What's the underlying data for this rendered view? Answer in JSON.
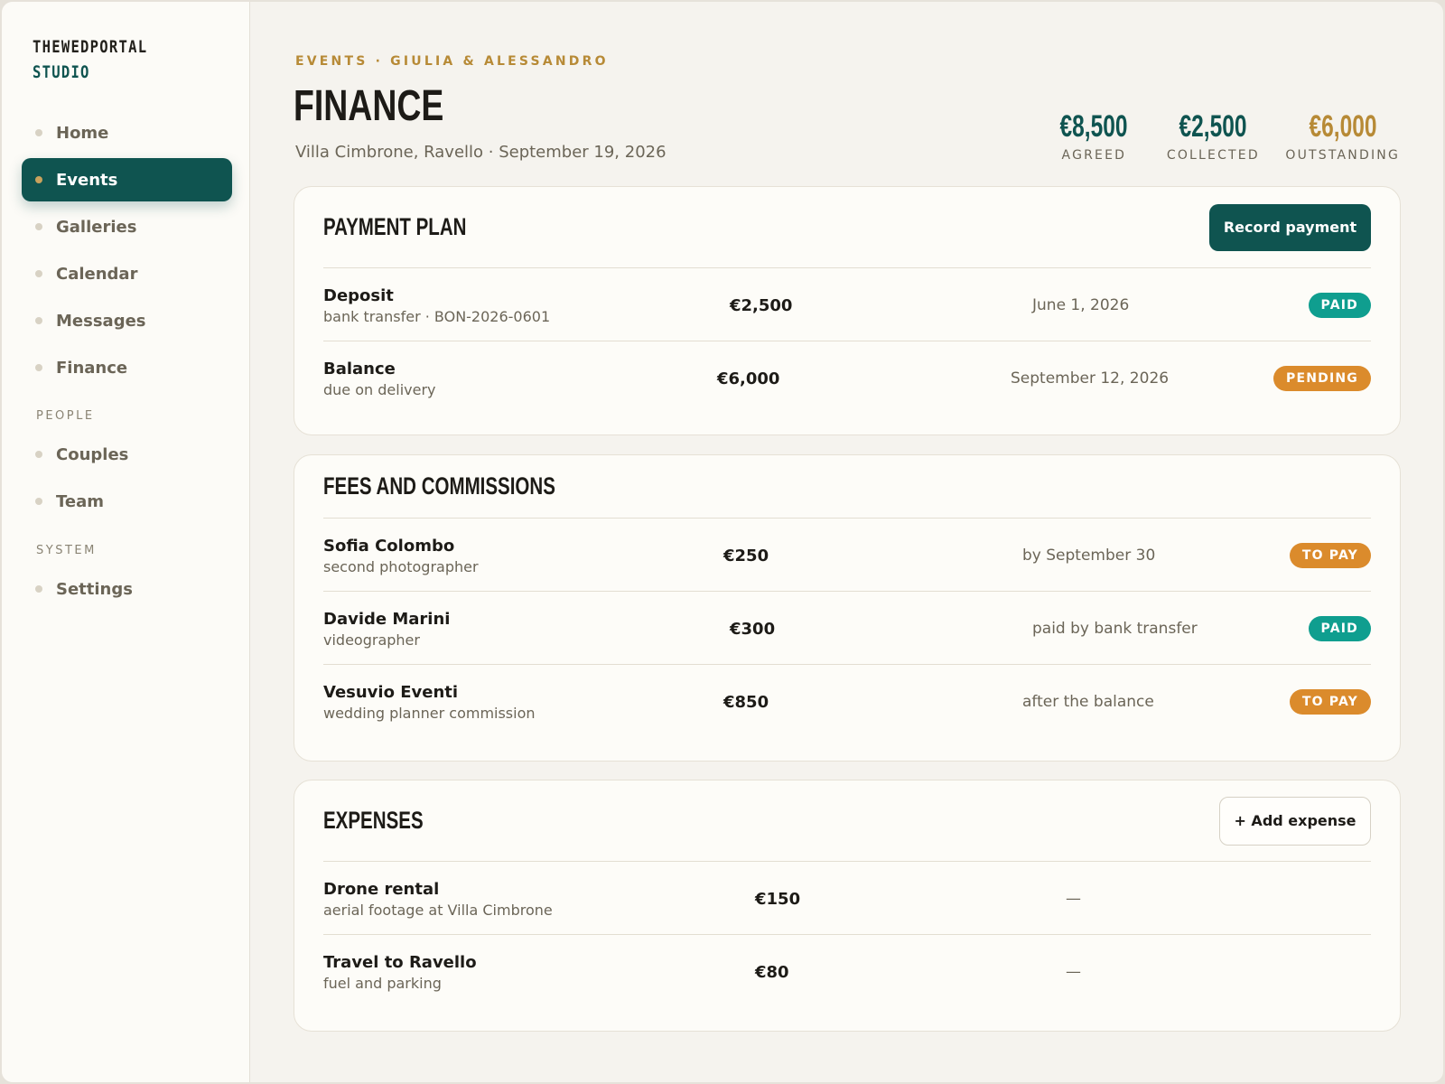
{
  "brand": {
    "line1": "THEWEDPORTAL",
    "line2": "STUDIO"
  },
  "sidebar": {
    "items": [
      {
        "label": "Home"
      },
      {
        "label": "Events"
      },
      {
        "label": "Galleries"
      },
      {
        "label": "Calendar"
      },
      {
        "label": "Messages"
      },
      {
        "label": "Finance"
      }
    ],
    "people_label": "PEOPLE",
    "people_items": [
      {
        "label": "Couples"
      },
      {
        "label": "Team"
      }
    ],
    "system_label": "SYSTEM",
    "system_items": [
      {
        "label": "Settings"
      }
    ]
  },
  "header": {
    "breadcrumb": "EVENTS · GIULIA & ALESSANDRO",
    "title": "FINANCE",
    "subtitle": "Villa Cimbrone, Ravello · September 19, 2026"
  },
  "stats": [
    {
      "value": "€8,500",
      "caption": "AGREED",
      "color": "#0f5450"
    },
    {
      "value": "€2,500",
      "caption": "COLLECTED",
      "color": "#0f5450"
    },
    {
      "value": "€6,000",
      "caption": "OUTSTANDING",
      "color": "#b78a36"
    }
  ],
  "payment_plan": {
    "title": "PAYMENT PLAN",
    "button": "Record payment",
    "rows": [
      {
        "name": "Deposit",
        "sub": "bank transfer · BON-2026-0601",
        "amount": "€2,500",
        "when": "June 1, 2026",
        "status": "PAID"
      },
      {
        "name": "Balance",
        "sub": "due on delivery",
        "amount": "€6,000",
        "when": "September 12, 2026",
        "status": "PENDING"
      }
    ]
  },
  "fees": {
    "title": "FEES AND COMMISSIONS",
    "rows": [
      {
        "name": "Sofia Colombo",
        "sub": "second photographer",
        "amount": "€250",
        "when": "by September 30",
        "status": "TO PAY"
      },
      {
        "name": "Davide Marini",
        "sub": "videographer",
        "amount": "€300",
        "when": "paid by bank transfer",
        "status": "PAID"
      },
      {
        "name": "Vesuvio Eventi",
        "sub": "wedding planner commission",
        "amount": "€850",
        "when": "after the balance",
        "status": "TO PAY"
      }
    ]
  },
  "expenses": {
    "title": "EXPENSES",
    "button": "+ Add expense",
    "rows": [
      {
        "name": "Drone rental",
        "sub": "aerial footage at Villa Cimbrone",
        "amount": "€150",
        "when": "—"
      },
      {
        "name": "Travel to Ravello",
        "sub": "fuel and parking",
        "amount": "€80",
        "when": "—"
      }
    ]
  }
}
